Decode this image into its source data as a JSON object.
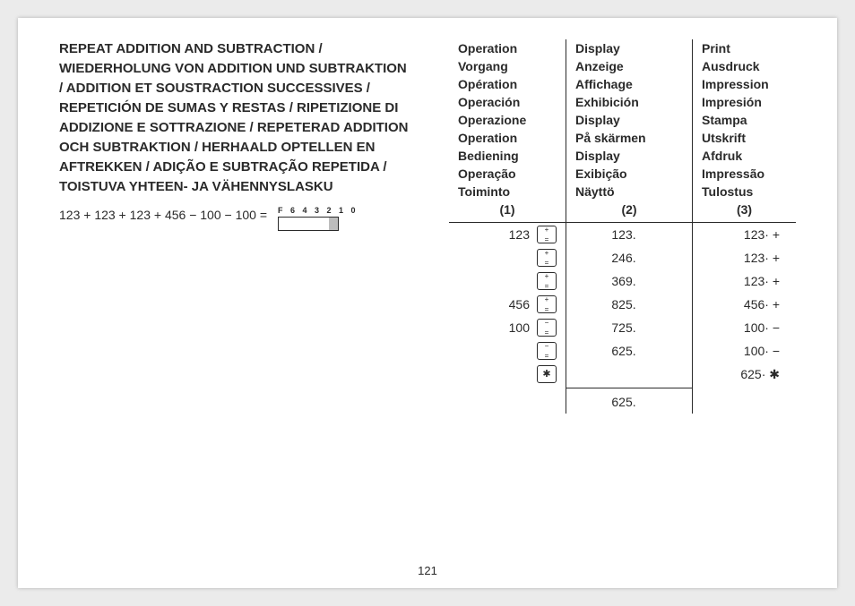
{
  "heading": "REPEAT ADDITION AND SUBTRACTION / WIEDERHOLUNG VON ADDITION UND SUBTRAKTION / ADDITION ET SOUSTRACTION SUCCESSIVES / REPETICIÓN DE SUMAS Y RESTAS / RIPETIZIONE DI ADDIZIONE E SOTTRAZIONE / REPETERAD ADDITION OCH SUBTRAKTION / HERHAALD OPTELLEN EN AFTREKKEN / ADIÇÃO E SUBTRAÇÃO REPETIDA / TOISTUVA YHTEEN- JA VÄHENNYSLASKU",
  "equation": "123 + 123 + 123 + 456 − 100 − 100 =",
  "selector_label": "F 6 4 3 2 1 0",
  "page_number": "121",
  "table": {
    "col1_head": [
      "Operation",
      "Vorgang",
      "Opération",
      "Operación",
      "Operazione",
      "Operation",
      "Bediening",
      "Operação",
      "Toiminto"
    ],
    "col2_head": [
      "Display",
      "Anzeige",
      "Affichage",
      "Exhibición",
      "Display",
      "På skärmen",
      "Display",
      "Exibição",
      "Näyttö"
    ],
    "col3_head": [
      "Print",
      "Ausdruck",
      "Impression",
      "Impresión",
      "Stampa",
      "Utskrift",
      "Afdruk",
      "Impressão",
      "Tulostus"
    ],
    "col1_num": "(1)",
    "col2_num": "(2)",
    "col3_num": "(3)",
    "rows": [
      {
        "op_num": "123",
        "op_key": "plus",
        "disp": "123.",
        "print": "123· +"
      },
      {
        "op_num": "",
        "op_key": "plus",
        "disp": "246.",
        "print": "123· +"
      },
      {
        "op_num": "",
        "op_key": "plus",
        "disp": "369.",
        "print": "123· +"
      },
      {
        "op_num": "456",
        "op_key": "plus",
        "disp": "825.",
        "print": "456· +"
      },
      {
        "op_num": "100",
        "op_key": "minus",
        "disp": "725.",
        "print": "100· −"
      },
      {
        "op_num": "",
        "op_key": "minus",
        "disp": "625.",
        "print": "100· −"
      },
      {
        "op_num": "",
        "op_key": "total",
        "disp": "",
        "print": "625· ✱"
      }
    ],
    "final_display": "625."
  }
}
